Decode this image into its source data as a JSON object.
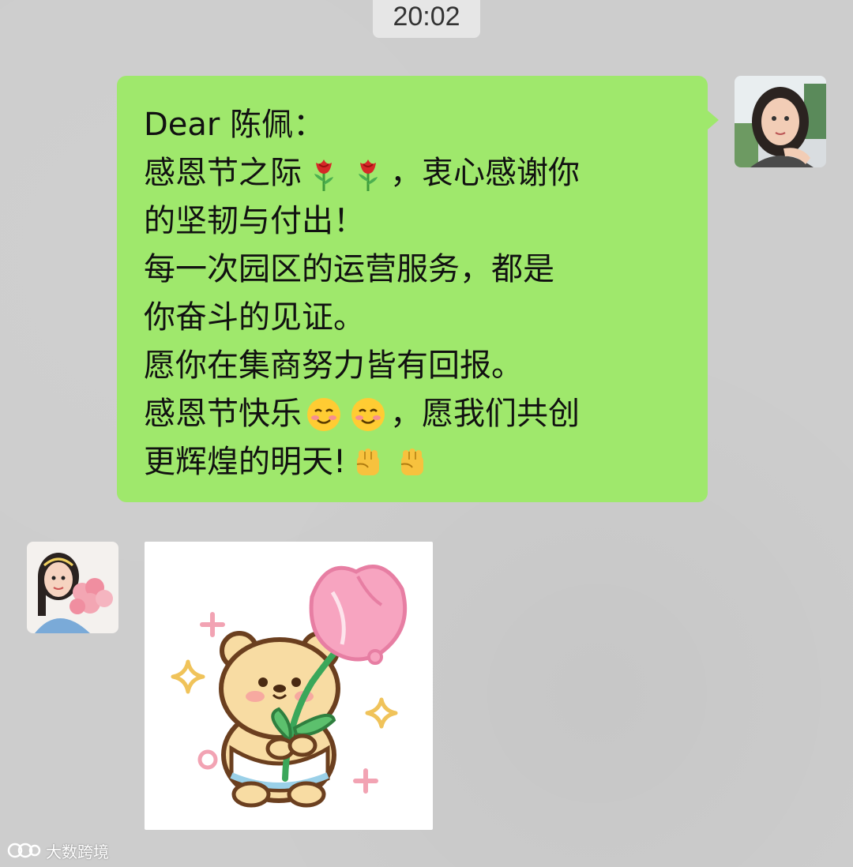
{
  "chat": {
    "timestamp": "20:02",
    "message_lines": {
      "l1": "Dear 陈佩：",
      "l2a": "感恩节之际",
      "l2b": "，衷心感谢你",
      "l3": "的坚韧与付出！",
      "l4": "每一次园区的运营服务，都是",
      "l5": "你奋斗的见证。",
      "l6": "愿你在集商努力皆有回报。",
      "l7a": "感恩节快乐",
      "l7b": "，愿我们共创",
      "l8a": "更辉煌的明天!"
    },
    "emojis": [
      "rose-emoji",
      "rose-emoji",
      "smiling-face-emoji",
      "smiling-face-emoji",
      "raised-fist-emoji",
      "raised-fist-emoji"
    ],
    "sticker": "bear-holding-tulip-sticker"
  },
  "watermark": {
    "text": "大数跨境"
  },
  "colors": {
    "bubble": "#9fe86c",
    "background": "#cdcdcd"
  }
}
